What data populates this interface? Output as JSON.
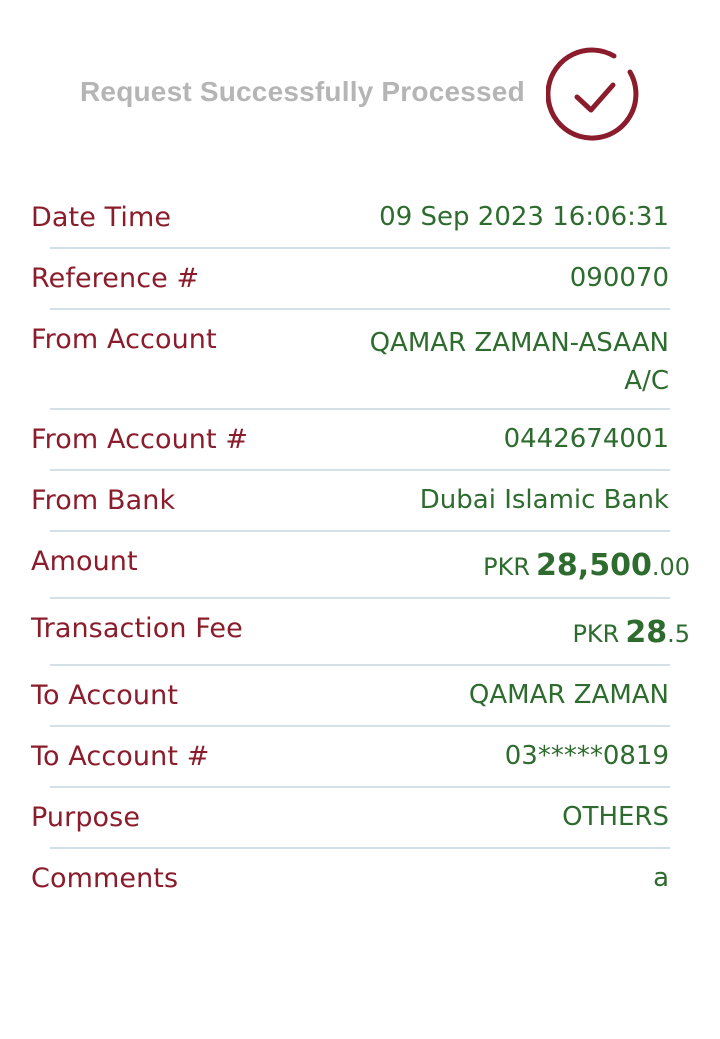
{
  "header": {
    "title": "Request Successfully Processed"
  },
  "colors": {
    "label": "#8a1c2b",
    "value": "#2e6b2e",
    "title": "#b5b5b5",
    "divider": "#d3e0e8",
    "check": "#8a1c2b"
  },
  "details": {
    "date_time": {
      "label": "Date Time",
      "value": "09 Sep 2023 16:06:31"
    },
    "reference": {
      "label": "Reference #",
      "value": "090070"
    },
    "from_account": {
      "label": "From Account",
      "value": "QAMAR ZAMAN-ASAAN A/C"
    },
    "from_account_no": {
      "label": "From Account #",
      "value": "0442674001"
    },
    "from_bank": {
      "label": "From Bank",
      "value": "Dubai Islamic Bank"
    },
    "amount": {
      "label": "Amount",
      "currency": "PKR",
      "major": "28,500",
      "minor": ".00"
    },
    "fee": {
      "label": "Transaction Fee",
      "currency": "PKR",
      "major": "28",
      "minor": ".5"
    },
    "to_account": {
      "label": "To Account",
      "value": "QAMAR ZAMAN"
    },
    "to_account_no": {
      "label": "To Account #",
      "value": "03*****0819"
    },
    "purpose": {
      "label": "Purpose",
      "value": "OTHERS"
    },
    "comments": {
      "label": "Comments",
      "value": "a"
    }
  }
}
